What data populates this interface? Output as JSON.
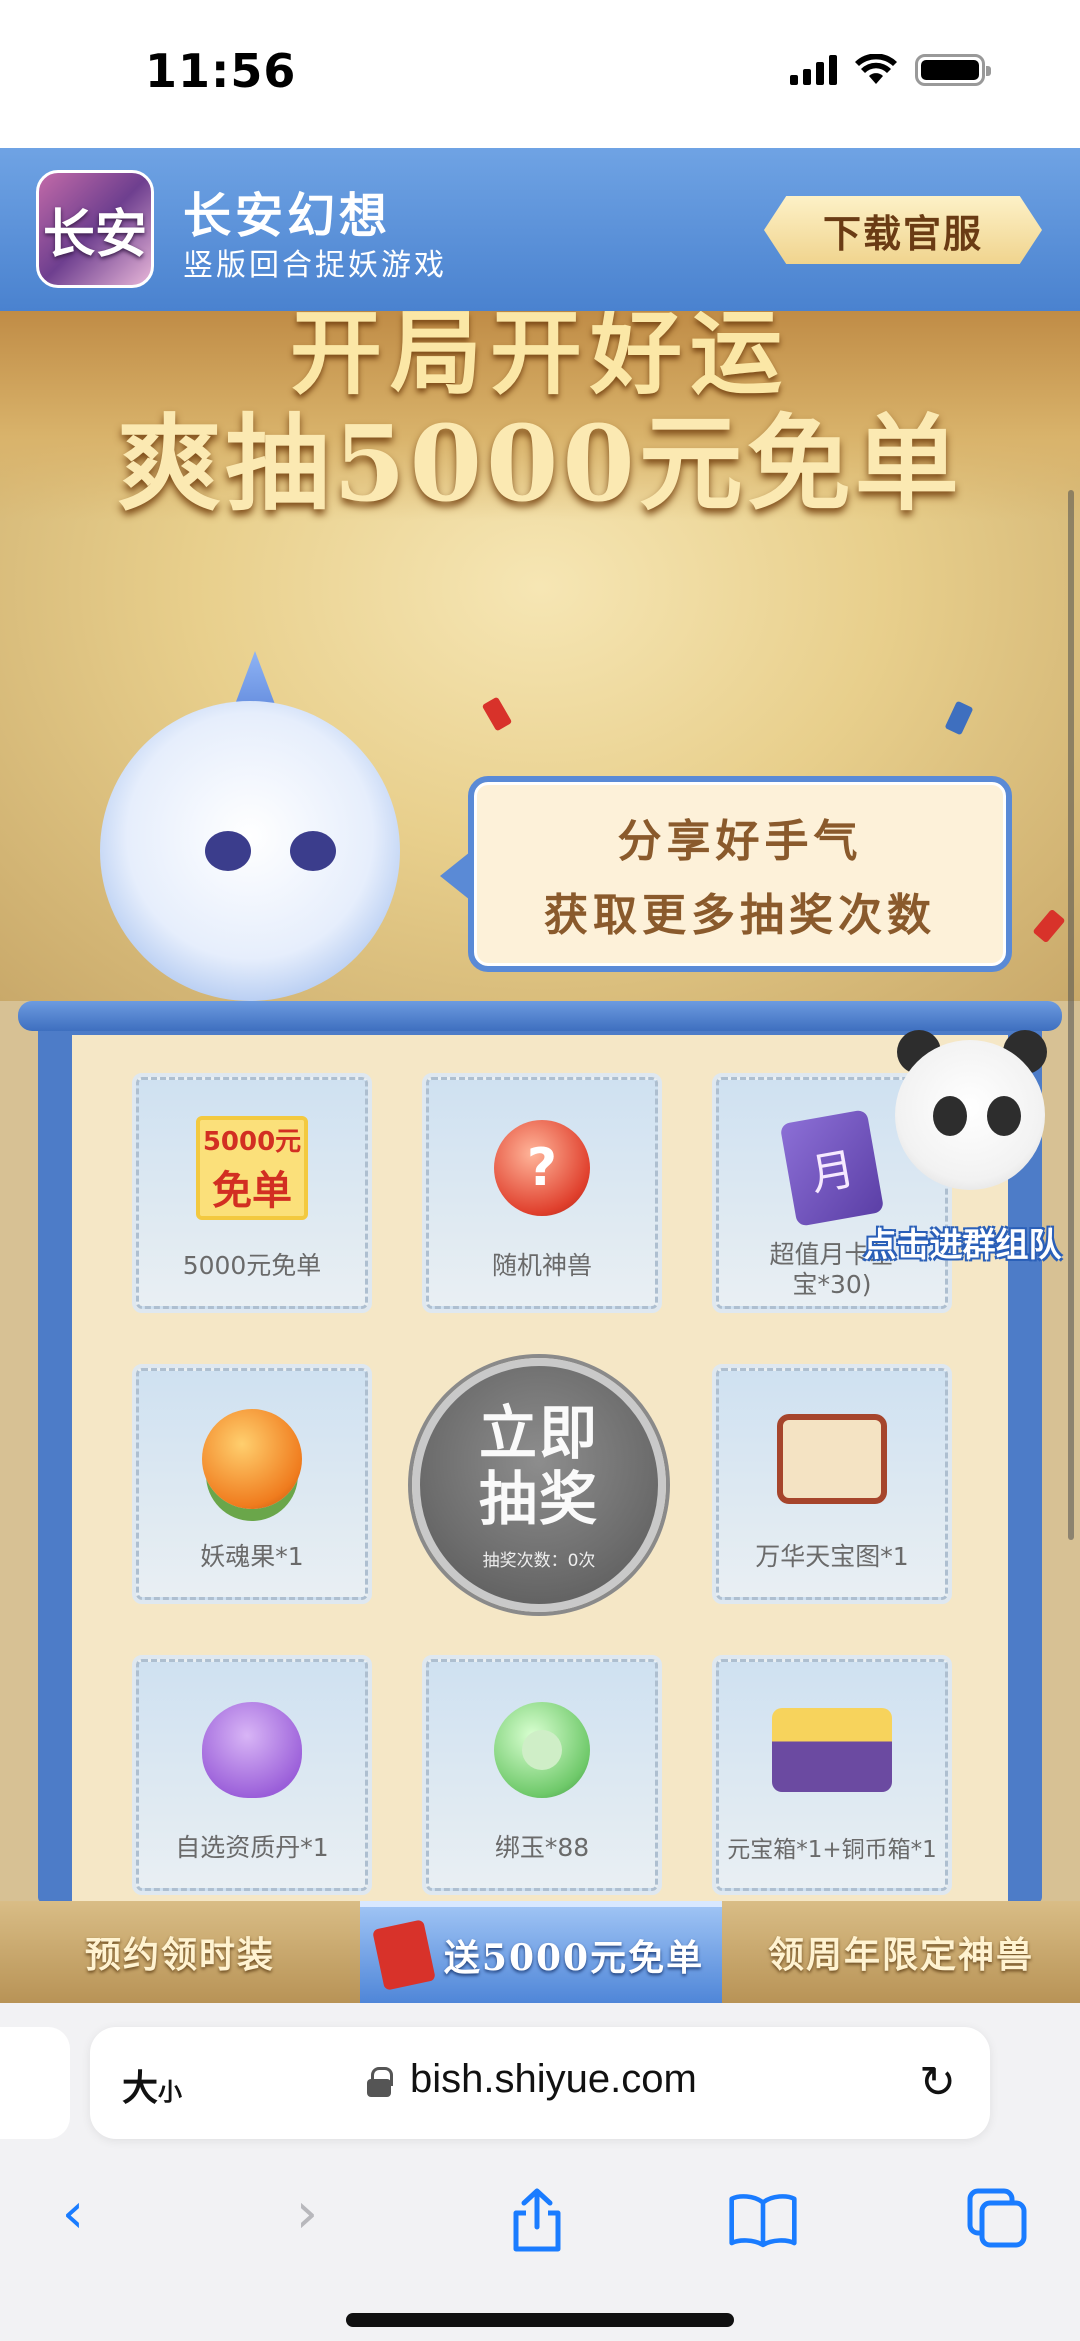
{
  "status": {
    "time": "11:56"
  },
  "game_header": {
    "logo_text": "长安",
    "title": "长安幻想",
    "subtitle": "竖版回合捉妖游戏",
    "download_button": "下载官服"
  },
  "hero": {
    "line1": "开局开好运",
    "line2": "爽抽5000元免单",
    "bubble_line1": "分享好手气",
    "bubble_line2": "获取更多抽奖次数"
  },
  "prizes": [
    {
      "label": "5000元免单",
      "icon": "free-order-icon",
      "icon_text_1": "5000元",
      "icon_text_2": "免单"
    },
    {
      "label": "随机神兽",
      "icon": "mystery-orb-icon",
      "icon_text": "?"
    },
    {
      "label": "超值月卡基",
      "label2": "宝*30)",
      "icon": "monthly-card-icon",
      "icon_text": "月"
    },
    {
      "label": "妖魂果*1",
      "icon": "soul-fruit-icon"
    },
    {
      "label": "万华天宝图*1",
      "icon": "treasure-map-icon"
    },
    {
      "label": "自选资质丹*1",
      "icon": "pill-bag-icon"
    },
    {
      "label": "绑玉*88",
      "icon": "jade-icon"
    },
    {
      "label": "元宝箱*1+铜币箱*1",
      "icon": "treasure-chest-icon"
    }
  ],
  "draw_button": {
    "line1": "立即",
    "line2": "抽奖",
    "count_text": "抽奖次数：0次"
  },
  "join_group": {
    "label": "点击进群组队"
  },
  "tabs": [
    {
      "label": "预约领时装"
    },
    {
      "label": "送5000元免单"
    },
    {
      "label": "领周年限定神兽"
    }
  ],
  "browser": {
    "text_size_label": "大",
    "text_size_small": "小",
    "url": "bish.shiyue.com",
    "reload_icon": "↻",
    "back_icon": "‹",
    "forward_icon": "›"
  }
}
